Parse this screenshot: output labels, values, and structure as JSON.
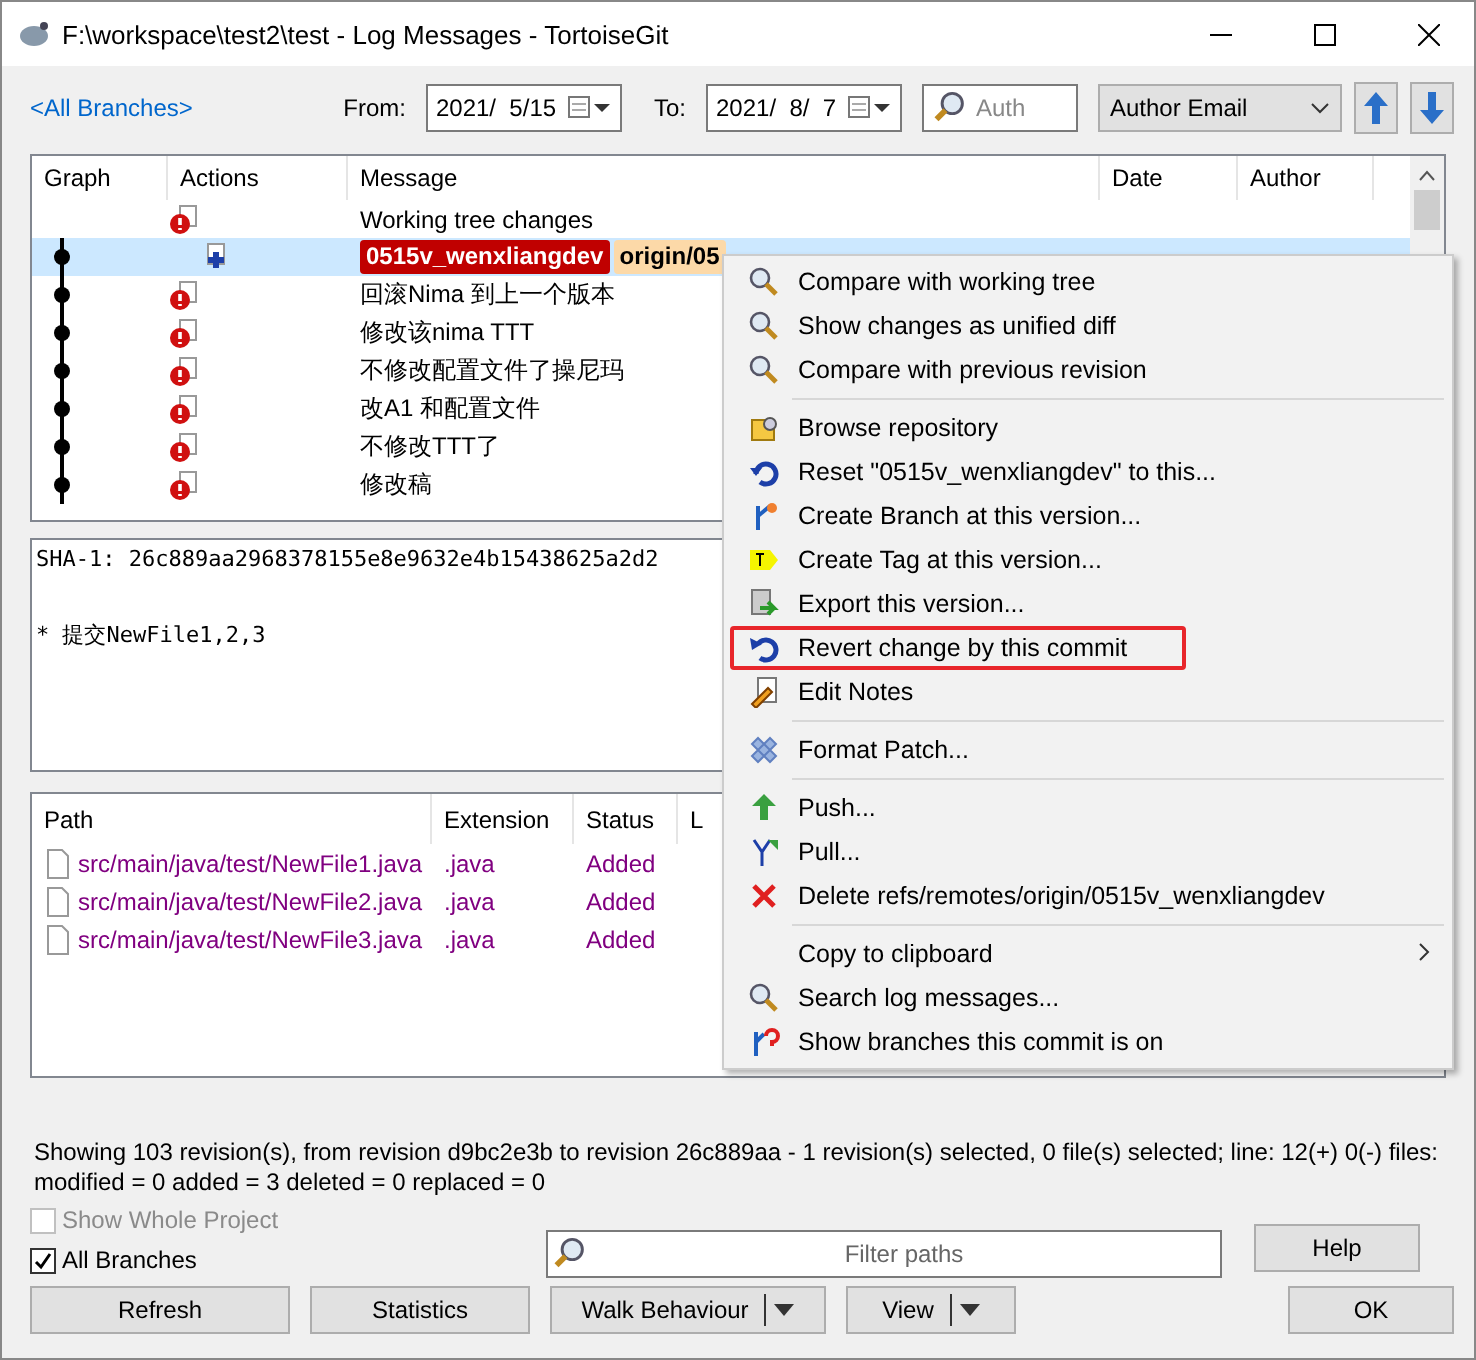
{
  "window": {
    "title": "F:\\workspace\\test2\\test - Log Messages - TortoiseGit"
  },
  "toolbar": {
    "branches_link": "<All Branches>",
    "from_label": "From:",
    "from_date": "2021/  5/15",
    "to_label": "To:",
    "to_date": "2021/  8/  7",
    "search": {
      "placeholder": "Auth"
    },
    "field_select": "Author Email"
  },
  "log": {
    "columns": [
      "Graph",
      "Actions",
      "Message",
      "Date",
      "Author"
    ],
    "rows": [
      {
        "kind": "working",
        "message": "Working tree changes",
        "selected": false,
        "refs": []
      },
      {
        "kind": "head",
        "message": "",
        "selected": true,
        "refs": [
          {
            "label": "0515v_wenxliangdev",
            "color": "#c00000"
          },
          {
            "label": "origin/05",
            "color": "#fcd9a8"
          }
        ]
      },
      {
        "kind": "commit",
        "message": "回滚Nima 到上一个版本",
        "selected": false,
        "refs": []
      },
      {
        "kind": "commit",
        "message": "修改该nima TTT",
        "selected": false,
        "refs": []
      },
      {
        "kind": "commit",
        "message": "不修改配置文件了操尼玛",
        "selected": false,
        "refs": []
      },
      {
        "kind": "commit",
        "message": "改A1 和配置文件",
        "selected": false,
        "refs": []
      },
      {
        "kind": "commit",
        "message": "不修改TTT了",
        "selected": false,
        "refs": []
      },
      {
        "kind": "commit",
        "message": "修改稿",
        "selected": false,
        "refs": []
      }
    ]
  },
  "details": {
    "sha": "SHA-1: 26c889aa2968378155e8e9632e4b15438625a2d2",
    "body": "* 提交NewFile1,2,3"
  },
  "files": {
    "columns": [
      "Path",
      "Extension",
      "Status",
      "L"
    ],
    "rows": [
      {
        "path": "src/main/java/test/NewFile1.java",
        "extension": ".java",
        "status": "Added"
      },
      {
        "path": "src/main/java/test/NewFile2.java",
        "extension": ".java",
        "status": "Added"
      },
      {
        "path": "src/main/java/test/NewFile3.java",
        "extension": ".java",
        "status": "Added"
      }
    ]
  },
  "context_menu": {
    "groups": [
      [
        {
          "label": "Compare with working tree",
          "highlighted": false,
          "has_submenu": false
        },
        {
          "label": "Show changes as unified diff",
          "highlighted": false,
          "has_submenu": false
        },
        {
          "label": "Compare with previous revision",
          "highlighted": false,
          "has_submenu": false
        }
      ],
      [
        {
          "label": "Browse repository",
          "highlighted": false,
          "has_submenu": false
        },
        {
          "label": "Reset \"0515v_wenxliangdev\" to this...",
          "highlighted": false,
          "has_submenu": false
        },
        {
          "label": "Create Branch at this version...",
          "highlighted": false,
          "has_submenu": false
        },
        {
          "label": "Create Tag at this version...",
          "highlighted": false,
          "has_submenu": false
        },
        {
          "label": "Export this version...",
          "highlighted": false,
          "has_submenu": false
        },
        {
          "label": "Revert change by this commit",
          "highlighted": true,
          "has_submenu": false
        },
        {
          "label": "Edit Notes",
          "highlighted": false,
          "has_submenu": false
        }
      ],
      [
        {
          "label": "Format Patch...",
          "highlighted": false,
          "has_submenu": false
        }
      ],
      [
        {
          "label": "Push...",
          "highlighted": false,
          "has_submenu": false
        },
        {
          "label": "Pull...",
          "highlighted": false,
          "has_submenu": false
        },
        {
          "label": "Delete refs/remotes/origin/0515v_wenxliangdev",
          "highlighted": false,
          "has_submenu": false
        }
      ],
      [
        {
          "label": "Copy to clipboard",
          "highlighted": false,
          "has_submenu": true
        },
        {
          "label": "Search log messages...",
          "highlighted": false,
          "has_submenu": false
        },
        {
          "label": "Show branches this commit is on",
          "highlighted": false,
          "has_submenu": false
        }
      ]
    ]
  },
  "status_bar": "Showing 103 revision(s), from revision d9bc2e3b to revision 26c889aa - 1 revision(s) selected, 0 file(s) selected; line: 12(+) 0(-) files: modified = 0 added = 3 deleted = 0 replaced = 0",
  "options": [
    {
      "label": "Show Whole Project",
      "checked": false,
      "disabled": true
    },
    {
      "label": "All Branches",
      "checked": true,
      "disabled": false
    }
  ],
  "filter": {
    "placeholder": "Filter paths"
  },
  "buttons": {
    "help": "Help",
    "refresh": "Refresh",
    "statistics": "Statistics",
    "walk": "Walk Behaviour",
    "view": "View",
    "ok": "OK"
  }
}
